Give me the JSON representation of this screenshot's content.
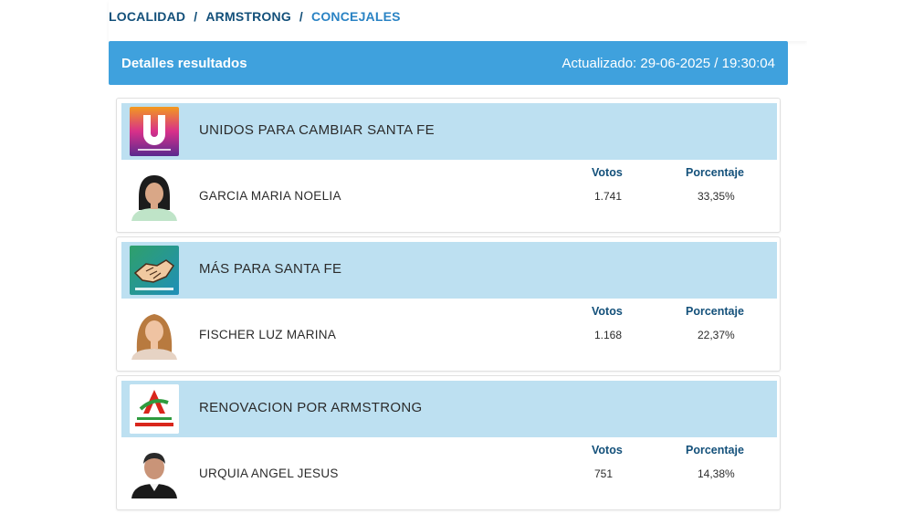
{
  "breadcrumb": {
    "items": [
      "LOCALIDAD",
      "ARMSTRONG",
      "CONCEJALES"
    ],
    "separator": "/"
  },
  "header": {
    "title": "Detalles resultados",
    "updated": "Actualizado: 29-06-2025 / 19:30:04"
  },
  "columns": {
    "votos": "Votos",
    "porcentaje": "Porcentaje"
  },
  "results": [
    {
      "party": "UNIDOS PARA CAMBIAR SANTA FE",
      "logo_caption": "UNIDOS PARA CAMBIAR SANTA FE",
      "candidate": "GARCIA MARIA NOELIA",
      "votos": "1.741",
      "porcentaje": "33,35%"
    },
    {
      "party": "MÁS PARA SANTA FE",
      "logo_caption": "MÁS PARA SANTA FE",
      "candidate": "FISCHER LUZ MARINA",
      "votos": "1.168",
      "porcentaje": "22,37%"
    },
    {
      "party": "RENOVACION POR ARMSTRONG",
      "logo_caption": "RENOVACIÓN POR ARMSTRONG",
      "candidate": "URQUIA ANGEL JESUS",
      "votos": "751",
      "porcentaje": "14,38%"
    }
  ],
  "colors": {
    "header_blue": "#3fa1dd",
    "party_row": "#bde0f1",
    "breadcrumb_dark": "#13507a",
    "breadcrumb_current": "#2a83c4"
  }
}
